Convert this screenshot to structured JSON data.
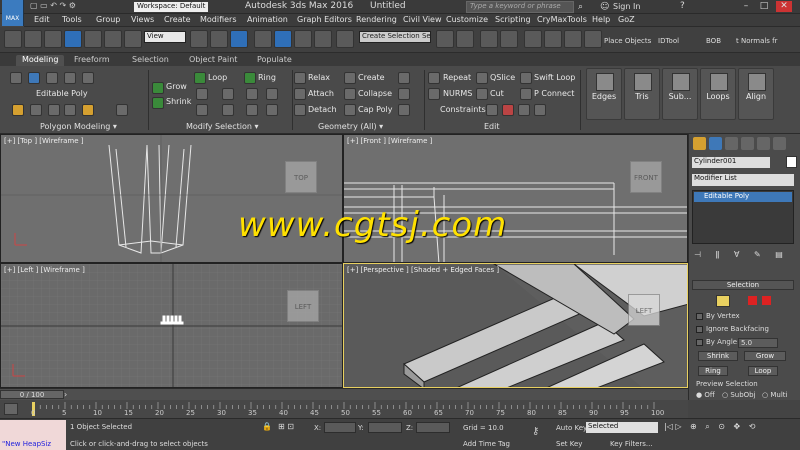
{
  "titlebar": {
    "logo": "MAX",
    "workspace": "Workspace: Default",
    "app_title": "Autodesk 3ds Max 2016",
    "doc_title": "Untitled",
    "search_placeholder": "Type a keyword or phrase",
    "sign_in": "Sign In",
    "win_min": "–",
    "win_max": "□",
    "win_close": "✕"
  },
  "menubar": [
    "Edit",
    "Tools",
    "Group",
    "Views",
    "Create",
    "Modifiers",
    "Animation",
    "Graph Editors",
    "Rendering",
    "Civil View",
    "Customize",
    "Scripting",
    "CryMaxTools",
    "Help",
    "GoZ"
  ],
  "toolbar": {
    "reference": "View",
    "selection_set": "Create Selection Se",
    "place_objects": "Place Objects",
    "idtool": "IDTool",
    "bob": "BOB",
    "normals": "t Normals fr"
  },
  "ribbon": {
    "tabs": [
      "Modeling",
      "Freeform",
      "Selection",
      "Object Paint",
      "Populate"
    ],
    "editable_poly": "Editable Poly",
    "grow": "Grow",
    "shrink": "Shrink",
    "loop": "Loop",
    "ring": "Ring",
    "relax": "Relax",
    "attach": "Attach",
    "detach": "Detach",
    "create": "Create",
    "collapse": "Collapse",
    "cap_poly": "Cap Poly",
    "repeat": "Repeat",
    "nurms": "NURMS",
    "qslice": "QSlice",
    "cut": "Cut",
    "swift_loop": "Swift Loop",
    "p_connect": "P Connect",
    "constraints": "Constraints:",
    "edges": "Edges",
    "tris": "Tris",
    "subd": "Sub...",
    "loops": "Loops",
    "align": "Align",
    "group_polygon": "Polygon Modeling ▾",
    "group_modify": "Modify Selection ▾",
    "group_geometry": "Geometry (All) ▾",
    "group_edit": "Edit"
  },
  "viewports": {
    "top": {
      "label": "[+] [Top ] [Wireframe ]",
      "cube": "TOP"
    },
    "front": {
      "label": "[+] [Front ] [Wireframe ]",
      "cube": "FRONT"
    },
    "left": {
      "label": "[+] [Left ] [Wireframe ]",
      "cube": "LEFT"
    },
    "persp": {
      "label": "[+] [Perspective ] [Shaded + Edged Faces ]",
      "cube": "LEFT"
    }
  },
  "command_panel": {
    "object_name": "Cylinder001",
    "modifier_list": "Modifier List",
    "stack_item": "Editable Poly",
    "selection": "Selection",
    "by_vertex": "By Vertex",
    "ignore_backfacing": "Ignore Backfacing",
    "by_angle": "By Angle:",
    "angle_value": "5.0",
    "shrink": "Shrink",
    "grow": "Grow",
    "ring": "Ring",
    "loop": "Loop",
    "preview_selection": "Preview Selection",
    "off": "Off",
    "subobj": "SubObj",
    "multi": "Multi"
  },
  "timeline": {
    "frame": "0 / 100",
    "ticks": [
      "0",
      "5",
      "10",
      "15",
      "20",
      "25",
      "30",
      "35",
      "40",
      "45",
      "50",
      "55",
      "60",
      "65",
      "70",
      "75",
      "80",
      "85",
      "90",
      "95",
      "100"
    ]
  },
  "status": {
    "maxscript": "\"New HeapSiz",
    "objects_selected": "1 Object Selected",
    "prompt": "Click or click-and-drag to select objects",
    "x": "X:",
    "y": "Y:",
    "z": "Z:",
    "grid": "Grid = 10.0",
    "add_time_tag": "Add Time Tag",
    "auto_key": "Auto Key",
    "set_key": "Set Key",
    "key_selected": "Selected",
    "key_filters": "Key Filters..."
  },
  "watermark": "www.cgtsj.com",
  "colors": {
    "accent": "#2f6fb8",
    "active_viewport_border": "#e8d060",
    "watermark": "#ffe100"
  }
}
